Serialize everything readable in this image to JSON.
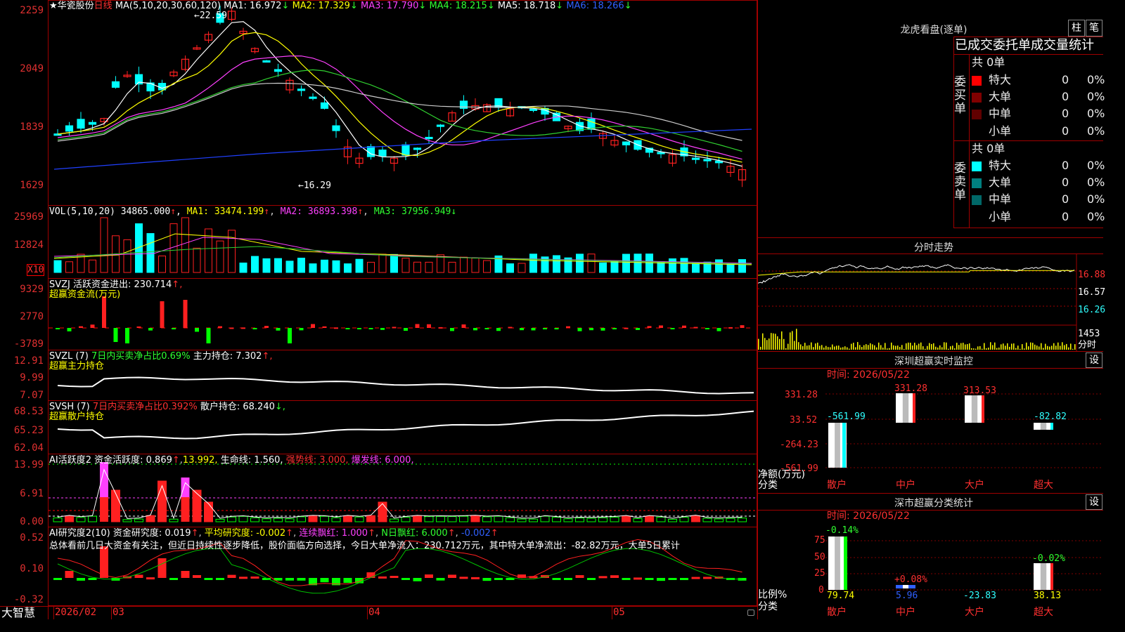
{
  "main": {
    "stock": "★华瓷股份",
    "period": "日线",
    "ma_title": "MA(5,10,20,30,60,120)",
    "ma": [
      {
        "t": "MA1: 16.972",
        "a": "↓"
      },
      {
        "t": "MA2: 17.329",
        "a": "↓"
      },
      {
        "t": "MA3: 17.790",
        "a": "↓"
      },
      {
        "t": "MA4: 18.215",
        "a": "↓"
      },
      {
        "t": "MA5: 18.718",
        "a": "↓"
      },
      {
        "t": "MA6: 18.266",
        "a": "↓"
      }
    ],
    "y": [
      "2259",
      "2049",
      "1839",
      "1629"
    ],
    "hi": "←22.59",
    "lo": "←16.29"
  },
  "colors": {
    "up": "#ff2020",
    "down": "#00ffff",
    "green": "#00ff00",
    "magenta": "#ff00ff",
    "yellow": "#ffff00",
    "blue": "#2040ff",
    "white": "#ffffff",
    "grid": "#a00000"
  },
  "vol": {
    "title": "VOL(5,10,20)",
    "v": "34865.000",
    "a": "↑",
    "ma1": "MA1: 33474.199",
    "ma2": "MA2: 36893.398",
    "ma3": "MA3: 37956.949",
    "y": [
      "25969",
      "12824"
    ],
    "unit": "X10"
  },
  "svzj": {
    "title": "SVZJ  活跃资金进出: 230.714",
    "a": "↑,",
    "sub": "超赢资金流(万元)",
    "y": [
      "9329",
      "2770",
      "-3789"
    ]
  },
  "svzl": {
    "title": "SVZL (7)",
    "p1": "7日内买卖净占比0.69%",
    "p2": "主力持仓: 7.302",
    "a": "↑,",
    "sub": "超赢主力持仓",
    "y": [
      "12.91",
      "9.99",
      "7.07"
    ]
  },
  "svsh": {
    "title": "SVSH (7)",
    "p1": "7日内买卖净占比0.392%",
    "p2": "散户持仓: 68.240",
    "a": "↓,",
    "sub": "超赢散户持仓",
    "y": [
      "68.53",
      "65.23",
      "62.04"
    ]
  },
  "ai2": {
    "title": "AI活跃度2",
    "p1": "资金活跃度: 0.869",
    "p2": "13.992,",
    "p3": "生命线: 1.560,",
    "p4": "强势线: 3.000,",
    "p5": "爆发线: 6.000,",
    "y": [
      "13.99",
      "6.91",
      "0.00"
    ]
  },
  "ai10": {
    "title": "AI研究度2(10)",
    "p1": "资金研究度: 0.019",
    "p2": "平均研究度: -0.002",
    "p3": "连续飘红: 1.000",
    "p4": "N日飘红: 6.000",
    "p5": "-0.002",
    "comment": "总体看前几日大资金有关注，但近日持续性逐步降低，股价面临方向选择，今日大单净流入：230.712万元，其中特大单净流出：-82.82万元，大单5日累计",
    "y": [
      "0.52",
      "0.10",
      "-0.32"
    ]
  },
  "xaxis": {
    "brand": "大智慧",
    "labels": [
      "2026/02",
      "03",
      "04",
      "05"
    ]
  },
  "lhb": {
    "title": "龙虎看盘(逐单)",
    "btn1": "柱",
    "btn2": "笔",
    "subtitle": "已成交委托单成交量统计",
    "buy": {
      "label": "委买单",
      "count": "共 0单",
      "rows": [
        {
          "n": "特大",
          "v": "0",
          "p": "0%",
          "c": "#ff0000"
        },
        {
          "n": "大单",
          "v": "0",
          "p": "0%",
          "c": "#800000"
        },
        {
          "n": "中单",
          "v": "0",
          "p": "0%",
          "c": "#600000"
        },
        {
          "n": "小单",
          "v": "0",
          "p": "0%",
          "c": "#000000"
        }
      ]
    },
    "sell": {
      "label": "委卖单",
      "count": "共 0单",
      "rows": [
        {
          "n": "特大",
          "v": "0",
          "p": "0%",
          "c": "#00ffff"
        },
        {
          "n": "大单",
          "v": "0",
          "p": "0%",
          "c": "#008080"
        },
        {
          "n": "中单",
          "v": "0",
          "p": "0%",
          "c": "#006868"
        },
        {
          "n": "小单",
          "v": "0",
          "p": "0%",
          "c": "#000000"
        }
      ]
    }
  },
  "fenshi": {
    "title": "分时走势",
    "y": [
      "16.88",
      "16.57",
      "16.26"
    ],
    "vol": "1453",
    "unit": "分时"
  },
  "szmon": {
    "title": "深圳超赢实时监控",
    "btn": "设",
    "time": "时间: 2026/05/22",
    "y": [
      "331.28",
      "33.52",
      "-264.23",
      "-561.99"
    ],
    "ylab": "净额(万元)",
    "xlab": "分类",
    "cats": [
      "散户",
      "中户",
      "大户",
      "超大"
    ],
    "vals": [
      "-561.99",
      "331.28",
      "313.53",
      "-82.82"
    ],
    "nums": [
      -561.99,
      331.28,
      313.53,
      -82.82
    ]
  },
  "szcls": {
    "title": "深市超赢分类统计",
    "btn": "设",
    "time": "时间: 2026/05/22",
    "y": [
      "75",
      "50",
      "25",
      "0"
    ],
    "ylab": "比例%",
    "xlab": "分类",
    "cats": [
      "散户",
      "中户",
      "大户",
      "超大"
    ],
    "top": [
      "-0.14%",
      "+0.08%",
      "",
      "-0.02%"
    ],
    "bottom": [
      "79.74",
      "5.96",
      "-23.83",
      "38.13"
    ],
    "nums": [
      79.74,
      5.96,
      0,
      38.13
    ]
  }
}
